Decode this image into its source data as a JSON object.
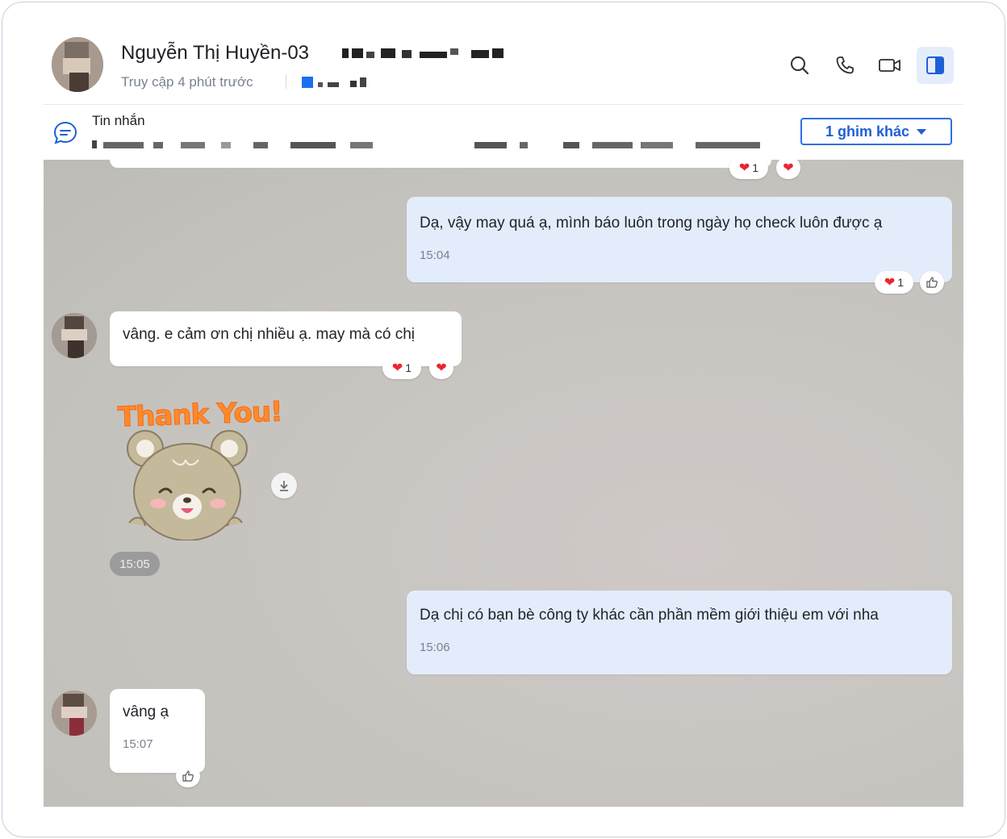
{
  "header": {
    "contact_name": "Nguyễn Thị Huyền-03",
    "status": "Truy cập 4 phút trước",
    "icons": [
      "search-icon",
      "phone-icon",
      "video-call-icon",
      "sidebar-toggle-icon"
    ]
  },
  "pinned": {
    "title": "Tin nhắn",
    "more_button": "1 ghim khác"
  },
  "messages": {
    "m1": {
      "text": "Dạ, vậy may quá ạ, mình báo luôn trong ngày họ check luôn được ạ",
      "time": "15:04",
      "heart_count": "1"
    },
    "m2": {
      "text": "vâng. e cảm ơn chị nhiều ạ. may mà có chị",
      "heart_count": "1"
    },
    "sticker": {
      "text": "Thank You!",
      "time": "15:05"
    },
    "m3": {
      "text": "Dạ chị có bạn bè công ty khác cần phần mềm giới thiệu em với nha",
      "time": "15:06"
    },
    "m4": {
      "text": "vâng ạ",
      "time": "15:07"
    },
    "top_reaction_count": "1"
  },
  "colors": {
    "accent": "#2f6fe4",
    "my_bubble": "#e3ecfb",
    "their_bubble": "#ffffff",
    "heart": "#e8262f"
  }
}
